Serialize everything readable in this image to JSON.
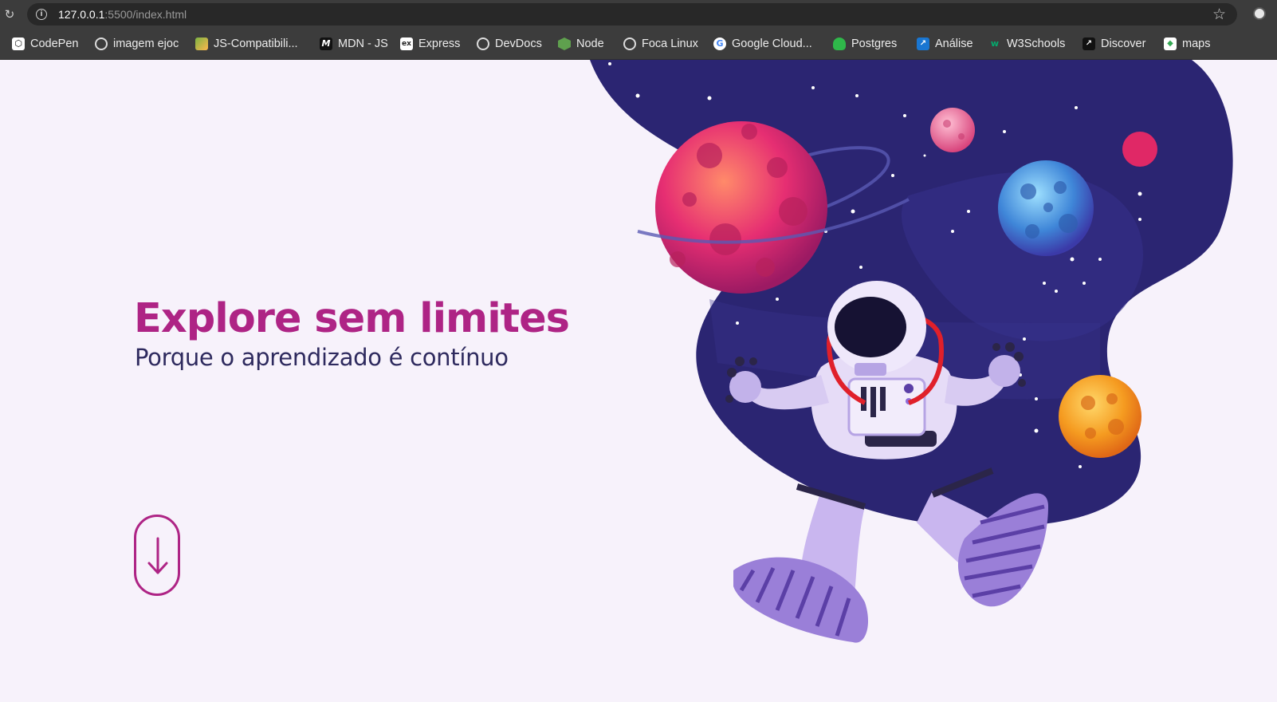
{
  "browser": {
    "url_host": "127.0.0.1",
    "url_path": ":5500/index.html",
    "bookmarks": [
      {
        "label": "CodePen",
        "icon": "codepen-icon"
      },
      {
        "label": "imagem ejoc",
        "icon": "globe-icon"
      },
      {
        "label": "JS-Compatibili...",
        "icon": "image-icon"
      },
      {
        "label": "MDN - JS",
        "icon": "mdn-icon"
      },
      {
        "label": "Express",
        "icon": "express-icon"
      },
      {
        "label": "DevDocs",
        "icon": "globe-icon"
      },
      {
        "label": "Node",
        "icon": "node-icon"
      },
      {
        "label": "Foca Linux",
        "icon": "globe-icon"
      },
      {
        "label": "Google Cloud...",
        "icon": "google-icon"
      },
      {
        "label": "Postgres",
        "icon": "elephant-icon"
      },
      {
        "label": "Análise",
        "icon": "chart-icon"
      },
      {
        "label": "W3Schools",
        "icon": "w3schools-icon"
      },
      {
        "label": "Discover",
        "icon": "discover-icon"
      },
      {
        "label": "maps",
        "icon": "maps-icon"
      }
    ]
  },
  "hero": {
    "title": "Explore sem limites",
    "subtitle": "Porque o aprendizado é contínuo"
  },
  "colors": {
    "accent": "#ae2485",
    "text_dark": "#2e2a5e",
    "background": "#f7f2fb",
    "space": "#2a2570"
  }
}
